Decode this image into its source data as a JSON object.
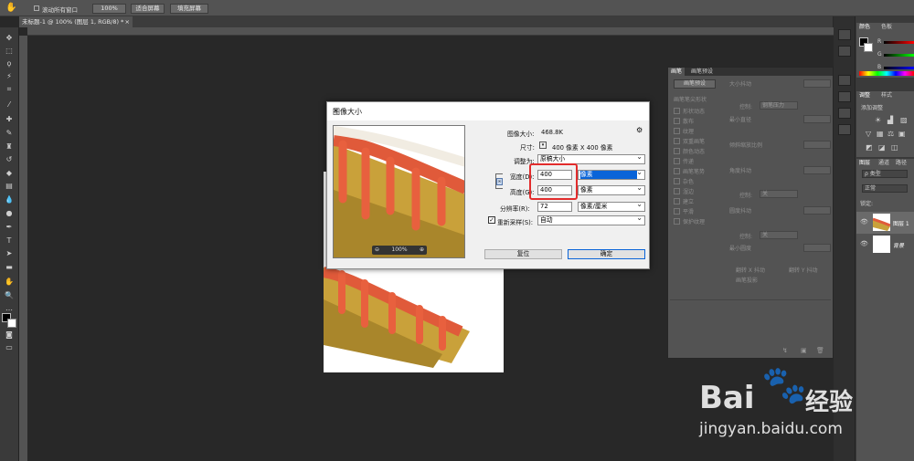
{
  "options_bar": {
    "scroll_all_label": "滚动所有窗口",
    "buttons": [
      "100%",
      "适合屏幕",
      "填充屏幕"
    ]
  },
  "document": {
    "tab_title": "未标题-1 @ 100% (图层 1, RGB/8) *",
    "close": "×"
  },
  "brush_panel": {
    "tabs": [
      "画笔",
      "画笔预设"
    ],
    "preset_button": "画笔预设",
    "section_header": "画笔笔尖形状",
    "options": [
      "形状动态",
      "散布",
      "纹理",
      "双重画笔",
      "颜色动态",
      "传递",
      "画笔笔势",
      "杂色",
      "湿边",
      "建立",
      "平滑",
      "保护纹理"
    ],
    "settings": [
      "大小抖动",
      "控制:",
      "钢笔压力",
      "最小直径",
      "倾斜缩放比例",
      "角度抖动",
      "控制:",
      "关",
      "圆度抖动",
      "控制:",
      "关",
      "最小圆度",
      "翻转 X 抖动",
      "翻转 Y 抖动",
      "画笔投影"
    ]
  },
  "right_panels": {
    "color_tabs": [
      "颜色",
      "色板"
    ],
    "color_letters": [
      "R",
      "G",
      "B"
    ],
    "adjust_tabs": [
      "调整",
      "样式"
    ],
    "adjust_title": "添加调整",
    "layers_tabs": [
      "图层",
      "通道",
      "路径"
    ],
    "kind_label": "ρ 类型",
    "blend_mode": "正常",
    "lock_label": "锁定:",
    "layers": [
      {
        "name": "图层 1"
      },
      {
        "name": "背景"
      }
    ]
  },
  "dialog": {
    "title": "图像大小",
    "close": "✕",
    "zoom": "100%",
    "image_size_label": "图像大小:",
    "image_size_value": "468.8K",
    "dimensions_label": "尺寸:",
    "dimensions_value": "400 像素  X  400 像素",
    "fit_label": "调整为:",
    "fit_value": "原稿大小",
    "width_label": "宽度(D):",
    "width_value": "400",
    "width_unit": "像素",
    "height_label": "高度(G):",
    "height_value": "400",
    "height_unit": "像素",
    "resolution_label": "分辨率(R):",
    "resolution_value": "72",
    "resolution_unit": "像素/厘米",
    "resample_label": "重新采样(S):",
    "resample_value": "自动",
    "reset_button": "复位",
    "ok_button": "确定"
  },
  "watermark": {
    "brand": "Bai",
    "brand2": "经验",
    "url": "jingyan.baidu.com"
  },
  "colors": {
    "highlight_red": "#e22c2c",
    "selection_blue": "#0a64d8",
    "ui_dark": "#282828"
  }
}
